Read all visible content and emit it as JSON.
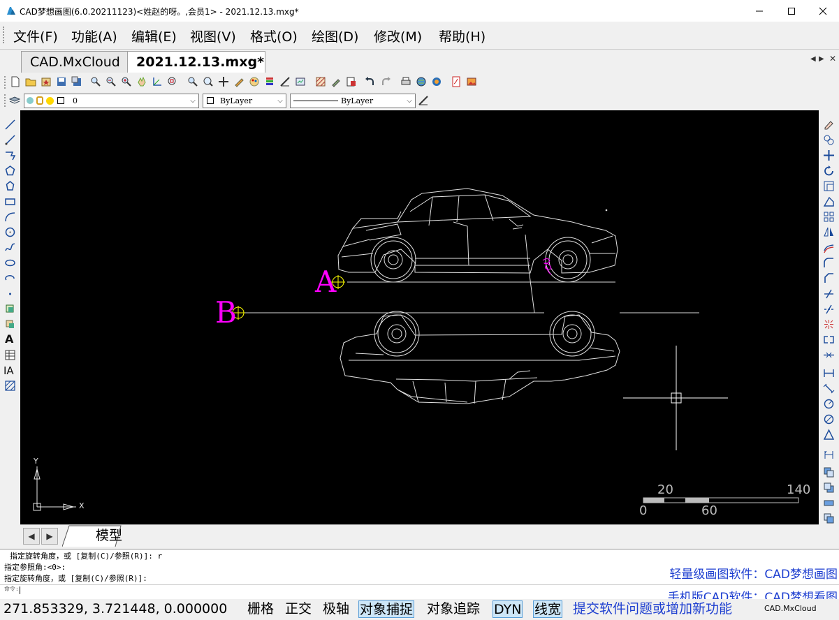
{
  "window": {
    "title": "CAD梦想画图(6.0.20211123)<姓赵的呀。,会员1> - 2021.12.13.mxg*"
  },
  "menu": [
    "文件(F)",
    "功能(A)",
    "编辑(E)",
    "视图(V)",
    "格式(O)",
    "绘图(D)",
    "修改(M)",
    "帮助(H)"
  ],
  "tabs": [
    "CAD.MxCloud",
    "2021.12.13.mxg*"
  ],
  "layer_toolbar": {
    "layer": "0",
    "color": "ByLayer",
    "linetype": "ByLayer"
  },
  "drawing": {
    "label_a": "A",
    "label_b": "B",
    "ucs_y": "Y",
    "ucs_x": "X",
    "scale_top": [
      "20",
      "140"
    ],
    "scale_bottom": [
      "0",
      "60"
    ]
  },
  "model_tab": "模型",
  "command_lines": [
    "指定旋转角度，或 [复制(C)/参照(R)]: r",
    "指定参照角:<0>:",
    " 指定旋转角度，或 [复制(C)/参照(R)]:",
    "命令:"
  ],
  "promo_lines": [
    "轻量级画图软件：CAD梦想画图",
    "手机版CAD软件：CAD梦想看图"
  ],
  "status": {
    "coords": "271.853329,  3.721448,  0.000000",
    "grid": "栅格",
    "ortho": "正交",
    "polar": "极轴",
    "osnap": "对象捕捉",
    "otrack": "对象追踪",
    "dyn": "DYN",
    "lwt": "线宽",
    "feedback": "提交软件问题或增加新功能",
    "brand": "CAD.MxCloud"
  },
  "colors": {
    "canvas": "#000000",
    "label": "#ff00ff",
    "snap_marker": "#ffff00",
    "promo": "#1e3fd0"
  }
}
